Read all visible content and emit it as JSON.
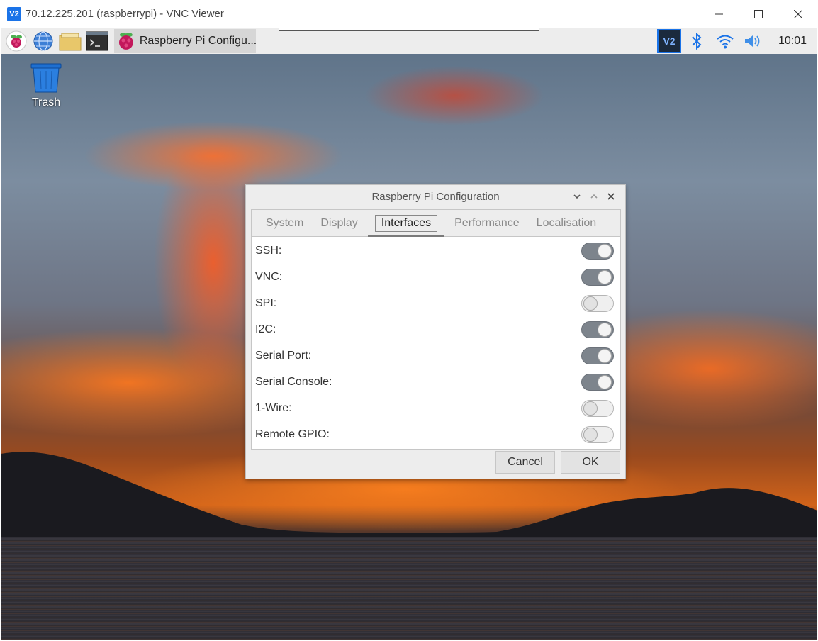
{
  "vnc_window": {
    "logo_text": "V2",
    "title": "70.12.225.201 (raspberrypi) - VNC Viewer"
  },
  "taskbar": {
    "task_label": "Raspberry Pi Configu...",
    "tray_vnc_text": "V2",
    "clock": "10:01"
  },
  "desktop": {
    "trash_label": "Trash"
  },
  "dialog": {
    "title": "Raspberry Pi Configuration",
    "tabs": [
      {
        "label": "System"
      },
      {
        "label": "Display"
      },
      {
        "label": "Interfaces"
      },
      {
        "label": "Performance"
      },
      {
        "label": "Localisation"
      }
    ],
    "active_tab": "Interfaces",
    "interfaces": [
      {
        "label": "SSH:",
        "enabled": true
      },
      {
        "label": "VNC:",
        "enabled": true
      },
      {
        "label": "SPI:",
        "enabled": false
      },
      {
        "label": "I2C:",
        "enabled": true
      },
      {
        "label": "Serial Port:",
        "enabled": true
      },
      {
        "label": "Serial Console:",
        "enabled": true
      },
      {
        "label": "1-Wire:",
        "enabled": false
      },
      {
        "label": "Remote GPIO:",
        "enabled": false
      }
    ],
    "cancel_label": "Cancel",
    "ok_label": "OK"
  },
  "colors": {
    "accent": "#1a73e8",
    "switch_on": "#7d848c",
    "switch_off": "#efefef"
  }
}
